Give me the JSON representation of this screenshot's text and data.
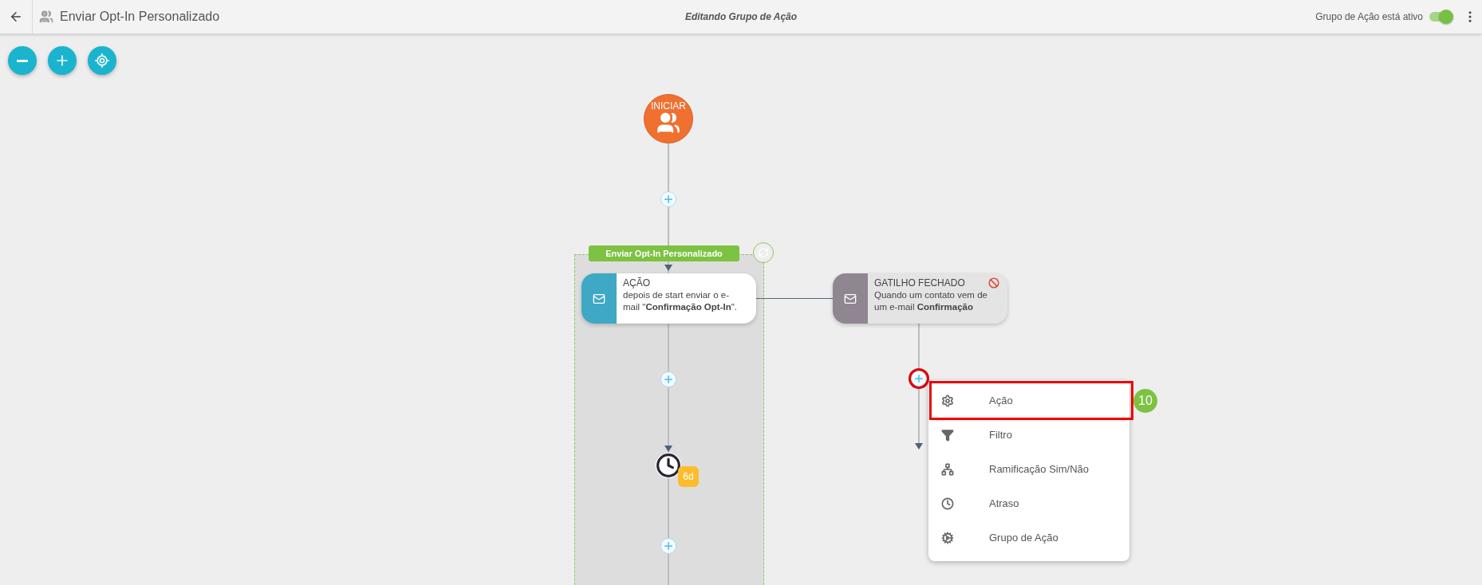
{
  "header": {
    "title": "Enviar Opt-In Personalizado",
    "center_title": "Editando Grupo de Ação",
    "status_label": "Grupo de Ação está ativo",
    "active_toggle": {
      "on": true
    }
  },
  "start_node": {
    "label": "INICIAR"
  },
  "group": {
    "label": "Enviar Opt-In Personalizado"
  },
  "nodes": [
    {
      "kind": "action",
      "title": "AÇÃO",
      "description": "depois de start enviar o e-mail \"**Confirmação Opt-In**\".",
      "disabled": false
    },
    {
      "kind": "trigger",
      "title": "GATILHO FECHADO",
      "description": "Quando um contato vem de um e-mail **Confirmação**",
      "disabled": true
    }
  ],
  "delay": {
    "badge": "6d"
  },
  "add_menu": {
    "items": [
      {
        "kind": "action",
        "label": "Ação",
        "highlighted": true
      },
      {
        "kind": "filter",
        "label": "Filtro",
        "highlighted": false
      },
      {
        "kind": "branch",
        "label": "Ramificação Sim/Não",
        "highlighted": false
      },
      {
        "kind": "delay",
        "label": "Atraso",
        "highlighted": false
      },
      {
        "kind": "group",
        "label": "Grupo de Ação",
        "highlighted": false
      }
    ]
  },
  "step_badge": "10"
}
